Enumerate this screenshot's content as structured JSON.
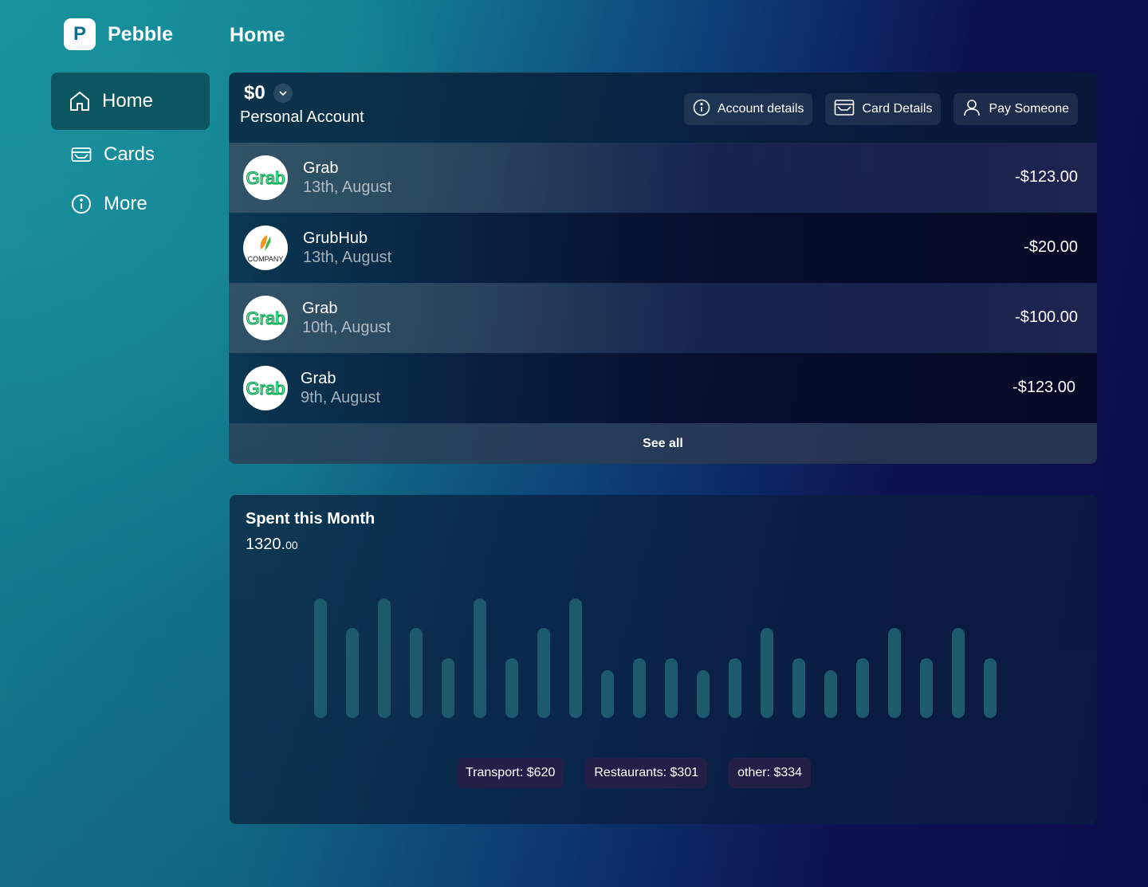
{
  "app": {
    "name": "Pebble",
    "logo_letter": "P",
    "page_title": "Home"
  },
  "sidebar": {
    "items": [
      {
        "label": "Home",
        "icon": "home-icon",
        "active": true
      },
      {
        "label": "Cards",
        "icon": "card-icon",
        "active": false
      },
      {
        "label": "More",
        "icon": "info-icon",
        "active": false
      }
    ]
  },
  "account": {
    "balance": "$0",
    "name": "Personal Account",
    "actions": [
      {
        "label": "Account details",
        "icon": "info-icon"
      },
      {
        "label": "Card Details",
        "icon": "card-icon"
      },
      {
        "label": "Pay Someone",
        "icon": "user-icon"
      }
    ],
    "transactions": [
      {
        "merchant": "Grab",
        "date": "13th, August",
        "amount": "-$123.00",
        "logo": "grab-logo",
        "logo_text": "Grab"
      },
      {
        "merchant": "GrubHub",
        "date": "13th, August",
        "amount": "-$20.00",
        "logo": "company-logo",
        "logo_text": "COMPANY"
      },
      {
        "merchant": "Grab",
        "date": "10th, August",
        "amount": "-$100.00",
        "logo": "grab-logo",
        "logo_text": "Grab"
      },
      {
        "merchant": "Grab",
        "date": "9th, August",
        "amount": "-$123.00",
        "logo": "grab-logo",
        "logo_text": "Grab"
      }
    ],
    "see_all_label": "See all"
  },
  "spending": {
    "title": "Spent this Month",
    "total_whole": "1320.",
    "total_cents": "00",
    "categories": [
      {
        "label": "Transport: $620"
      },
      {
        "label": "Restaurants: $301"
      },
      {
        "label": "other: $334"
      }
    ]
  },
  "chart_data": {
    "type": "bar",
    "values": [
      4,
      3,
      4,
      3,
      2,
      4,
      2,
      3,
      4,
      1.6,
      2,
      2,
      1.6,
      2,
      3,
      2,
      1.6,
      2,
      3,
      2,
      3,
      2
    ],
    "color": "#1e5a6e"
  },
  "colors": {
    "accent": "#0b5660",
    "grab_green": "#00a651",
    "bar": "#1e5a6e"
  }
}
